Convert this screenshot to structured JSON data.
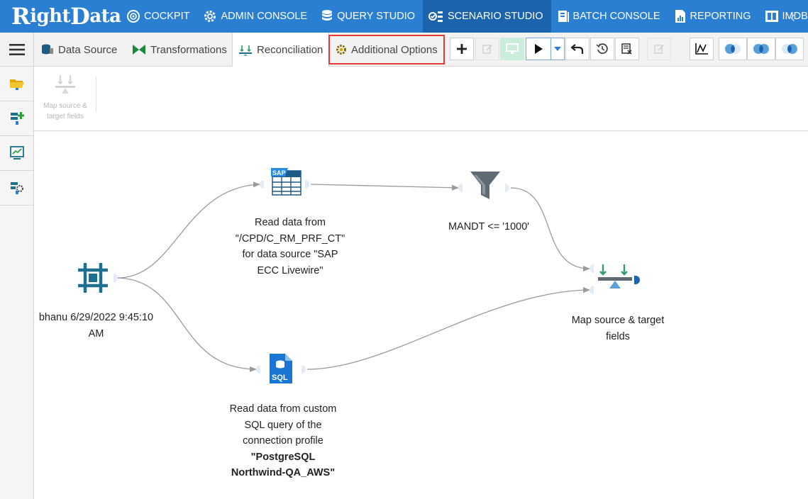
{
  "app": {
    "logo_text_1": "R",
    "logo_text_2": "ight",
    "logo_text_3": "D",
    "logo_text_4": "ata"
  },
  "nav": {
    "items": [
      {
        "label": "COCKPIT",
        "icon": "gauge-icon"
      },
      {
        "label": "ADMIN CONSOLE",
        "icon": "gear-icon"
      },
      {
        "label": "QUERY STUDIO",
        "icon": "database-icon"
      },
      {
        "label": "SCENARIO STUDIO",
        "icon": "scenario-icon",
        "active": true
      },
      {
        "label": "BATCH CONSOLE",
        "icon": "batch-icon"
      },
      {
        "label": "REPORTING",
        "icon": "report-icon"
      },
      {
        "label": "IMDB",
        "icon": "imdb-icon"
      }
    ],
    "collapse_glyph": "‹"
  },
  "tabs": {
    "data_source": "Data Source",
    "transformations": "Transformations",
    "reconciliation": "Reconciliation",
    "additional_options": "Additional Options"
  },
  "ribbon": {
    "map_fields_label_1": "Map source &",
    "map_fields_label_2": "target fields"
  },
  "nodes": {
    "start": {
      "line1": "bhanu 6/29/2022 9:45:10",
      "line2": "AM"
    },
    "sap": {
      "line1": "Read data from",
      "line2": "\"/CPD/C_RM_PRF_CT\"",
      "line3": "for data source \"SAP",
      "line4": "ECC Livewire\""
    },
    "sql": {
      "line1": "Read data from custom",
      "line2": "SQL query of the",
      "line3": "connection profile",
      "line4": "\"PostgreSQL",
      "line5": "Northwind-QA_AWS\""
    },
    "filter": {
      "line1": "MANDT <= '1000'"
    },
    "map": {
      "line1": "Map source & target",
      "line2": "fields"
    }
  },
  "colors": {
    "nav_bg": "#2b7fd2",
    "nav_active": "#1b63ad",
    "highlight": "#e53935",
    "node_teal": "#1d6f8f",
    "sql_blue": "#1976d2"
  }
}
